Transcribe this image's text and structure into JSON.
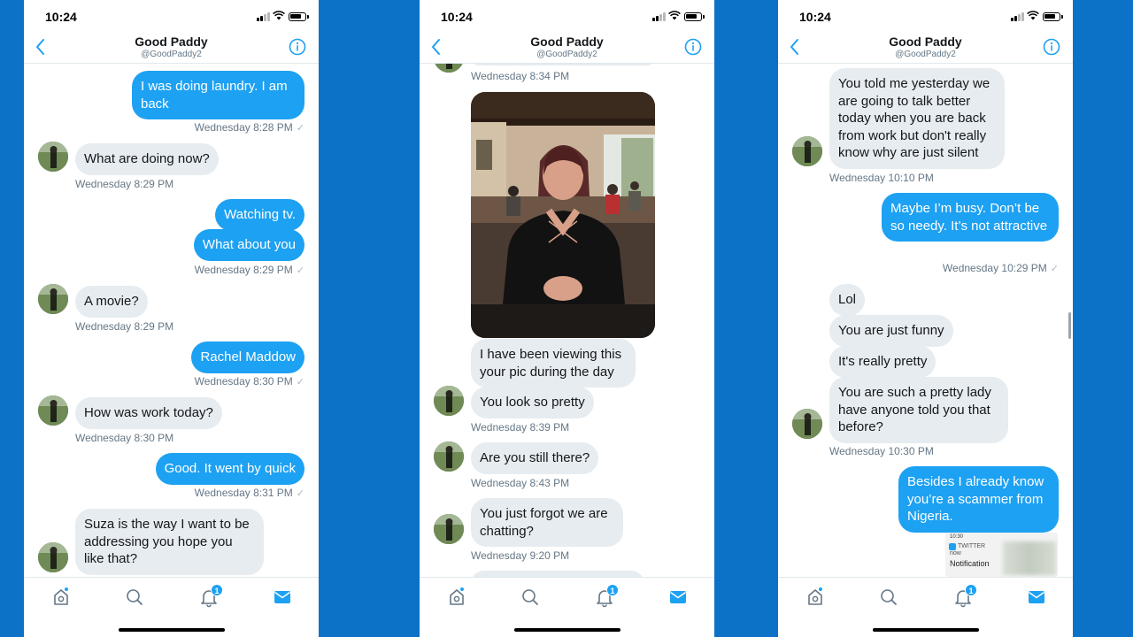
{
  "status": {
    "time": "10:24"
  },
  "header": {
    "name": "Good Paddy",
    "handle": "@GoodPaddy2"
  },
  "tabbar": {
    "notification_badge": "1"
  },
  "panel1": {
    "msgs": [
      {
        "text": "I was doing laundry.  I am back"
      },
      {
        "text": "Wednesday 8:28 PM"
      },
      {
        "text": "What are doing now?"
      },
      {
        "text": "Wednesday 8:29 PM"
      },
      {
        "text": "Watching tv."
      },
      {
        "text": "What about you"
      },
      {
        "text": "Wednesday 8:29 PM"
      },
      {
        "text": "A movie?"
      },
      {
        "text": "Wednesday 8:29 PM"
      },
      {
        "text": "Rachel Maddow"
      },
      {
        "text": "Wednesday 8:30 PM"
      },
      {
        "text": "How was work today?"
      },
      {
        "text": "Wednesday 8:30 PM"
      },
      {
        "text": "Good.  It went by quick"
      },
      {
        "text": "Wednesday 8:31 PM"
      },
      {
        "text": "Suza is the way I want to be addressing you hope you like that?"
      }
    ]
  },
  "panel2": {
    "msgs": [
      {
        "text": "Wednesday 8:34 PM"
      },
      {
        "text": "I have been viewing this your pic during the day"
      },
      {
        "text": "You look so pretty"
      },
      {
        "text": "Wednesday 8:39 PM"
      },
      {
        "text": "Are you still there?"
      },
      {
        "text": "Wednesday 8:43 PM"
      },
      {
        "text": "You just forgot we are chatting?"
      },
      {
        "text": "Wednesday 9:20 PM"
      }
    ]
  },
  "panel3": {
    "msgs": [
      {
        "text": "You told me yesterday we are going to talk better today when you are back from work but don't really know why are just silent"
      },
      {
        "text": "Wednesday 10:10 PM"
      },
      {
        "text": "Maybe I’m busy.  Don’t be so needy.   It’s not attractive"
      },
      {
        "text": "Wednesday 10:29 PM"
      },
      {
        "text": "Lol"
      },
      {
        "text": "You are just funny"
      },
      {
        "text": "It's really pretty"
      },
      {
        "text": "You are such a pretty lady have anyone told you that before?"
      },
      {
        "text": "Wednesday 10:30 PM"
      },
      {
        "text": "Besides I already know you’re a scammer from Nigeria."
      }
    ],
    "notification": {
      "time": "10:30",
      "app": "TWITTER",
      "when": "now",
      "title": "Notification"
    }
  }
}
